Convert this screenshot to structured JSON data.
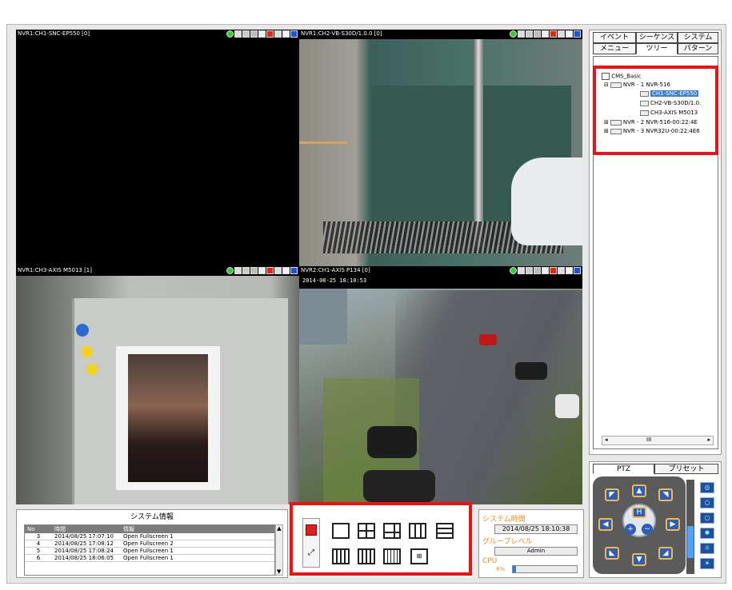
{
  "panes": [
    {
      "caption": "NVR1:CH1-SNC-EP550 [0]"
    },
    {
      "caption": "NVR1:CH2-VB-S30D/1.0.0 [0]"
    },
    {
      "caption": "NVR1:CH3-AXIS M5013 [1]"
    },
    {
      "caption": "NVR2:CH1-AXIS P134 [0]",
      "timestamp": "2014-08-25 18:10:53"
    }
  ],
  "tabs": {
    "row1": [
      "イベント",
      "シーケンス",
      "システム"
    ],
    "row2": [
      "メニュー",
      "ツリー",
      "パターン"
    ],
    "active": "ツリー"
  },
  "tree": {
    "root": "CMS_Basic",
    "nvr1": "NVR - 1 NVR-516",
    "ch1": "CH1-SNC-EP550",
    "ch2": "CH2-VB-S30D/1.0.",
    "ch3": "CH3-AXIS M5013",
    "nvr2": "NVR - 2 NVR-516-00:22:4E",
    "nvr3": "NVR - 3 NVR32U-00:22:4E6"
  },
  "scrollbar": {
    "thumb_label": "III"
  },
  "ptz_tabs": [
    "PTZ",
    "プリセット"
  ],
  "ptz": {
    "home_label": "H"
  },
  "sysinfo": {
    "title": "システム情報",
    "columns": [
      "No",
      "時間",
      "情報"
    ],
    "rows": [
      [
        "3",
        "2014/08/25 17:07:10",
        "Open Fullscreen 1"
      ],
      [
        "4",
        "2014/08/25 17:08:12",
        "Open Fullscreen 2"
      ],
      [
        "5",
        "2014/08/25 17:08:24",
        "Open Fullscreen 1"
      ],
      [
        "6",
        "2014/08/25 18:06:05",
        "Open Fullscreen 1"
      ]
    ]
  },
  "status": {
    "time_label": "システム時間",
    "time_value": "2014/08/25 18:10:38",
    "group_label": "グループレベル",
    "group_value": "Admin",
    "cpu_label": "CPU",
    "cpu_value": "8%",
    "cpu_fraction": 0.05
  },
  "colors": {
    "highlight": "#e11111",
    "selection": "#3a7ee0",
    "accent_orange": "#f08a1c"
  }
}
